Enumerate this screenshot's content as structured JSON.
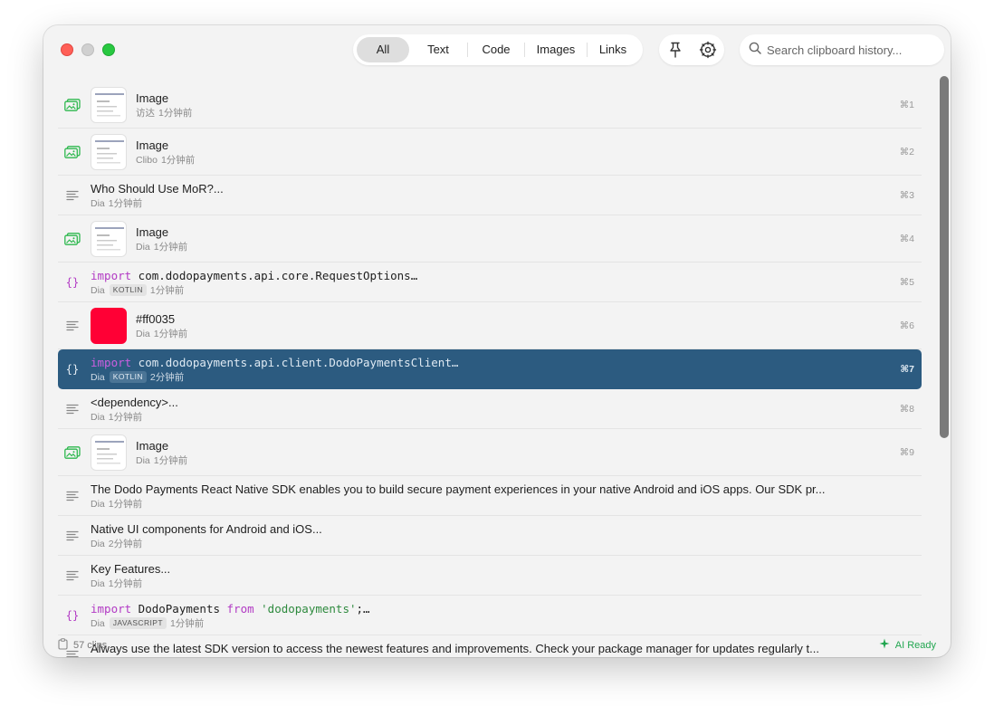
{
  "filters": [
    {
      "label": "All",
      "active": true
    },
    {
      "label": "Text",
      "active": false
    },
    {
      "label": "Code",
      "active": false
    },
    {
      "label": "Images",
      "active": false
    },
    {
      "label": "Links",
      "active": false
    }
  ],
  "toolbar": {
    "pin_icon": "pin-icon",
    "settings_icon": "gear-icon"
  },
  "search": {
    "placeholder": "Search clipboard history..."
  },
  "items": [
    {
      "type": "image",
      "title": "Image",
      "source": "访达",
      "time": "1分钟前",
      "shortcut": "⌘1"
    },
    {
      "type": "image",
      "title": "Image",
      "source": "Clibo",
      "time": "1分钟前",
      "shortcut": "⌘2"
    },
    {
      "type": "text",
      "title": "Who Should Use MoR?...",
      "source": "Dia",
      "time": "1分钟前",
      "shortcut": "⌘3"
    },
    {
      "type": "image",
      "title": "Image",
      "source": "Dia",
      "time": "1分钟前",
      "shortcut": "⌘4"
    },
    {
      "type": "code",
      "kw": "import",
      "rest": " com.dodopayments.api.core.RequestOptions…",
      "source": "Dia",
      "lang": "KOTLIN",
      "time": "1分钟前",
      "shortcut": "⌘5"
    },
    {
      "type": "color",
      "title": "#ff0035",
      "color": "#ff0035",
      "source": "Dia",
      "time": "1分钟前",
      "shortcut": "⌘6"
    },
    {
      "type": "code",
      "kw": "import",
      "rest": " com.dodopayments.api.client.DodoPaymentsClient…",
      "source": "Dia",
      "lang": "KOTLIN",
      "time": "2分钟前",
      "shortcut": "⌘7",
      "selected": true
    },
    {
      "type": "text",
      "title": "<dependency>...",
      "source": "Dia",
      "time": "1分钟前",
      "shortcut": "⌘8"
    },
    {
      "type": "image",
      "title": "Image",
      "source": "Dia",
      "time": "1分钟前",
      "shortcut": "⌘9"
    },
    {
      "type": "text",
      "title": "The Dodo Payments React Native SDK enables you to build secure payment experiences in your native Android and iOS apps. Our SDK pr...",
      "source": "Dia",
      "time": "1分钟前",
      "shortcut": ""
    },
    {
      "type": "text",
      "title": "Native UI components for Android and iOS...",
      "source": "Dia",
      "time": "2分钟前",
      "shortcut": ""
    },
    {
      "type": "text",
      "title": "Key Features...",
      "source": "Dia",
      "time": "1分钟前",
      "shortcut": ""
    },
    {
      "type": "code",
      "kw": "import",
      "mid": " DodoPayments ",
      "kw2": "from",
      "str": " 'dodopayments'",
      "tail": ";…",
      "source": "Dia",
      "lang": "JAVASCRIPT",
      "time": "1分钟前",
      "shortcut": ""
    },
    {
      "type": "text",
      "title": "Always use the latest SDK version to access the newest features and improvements. Check your package manager for updates regularly t...",
      "source": "",
      "time": "",
      "shortcut": ""
    }
  ],
  "footer": {
    "clips": "57 clips",
    "ai_status": "AI Ready"
  },
  "colors": {
    "accent_selected": "#2c5b80",
    "image_icon": "#2fb84f",
    "code_icon": "#b23ac4",
    "ai_ready": "#22a650"
  }
}
